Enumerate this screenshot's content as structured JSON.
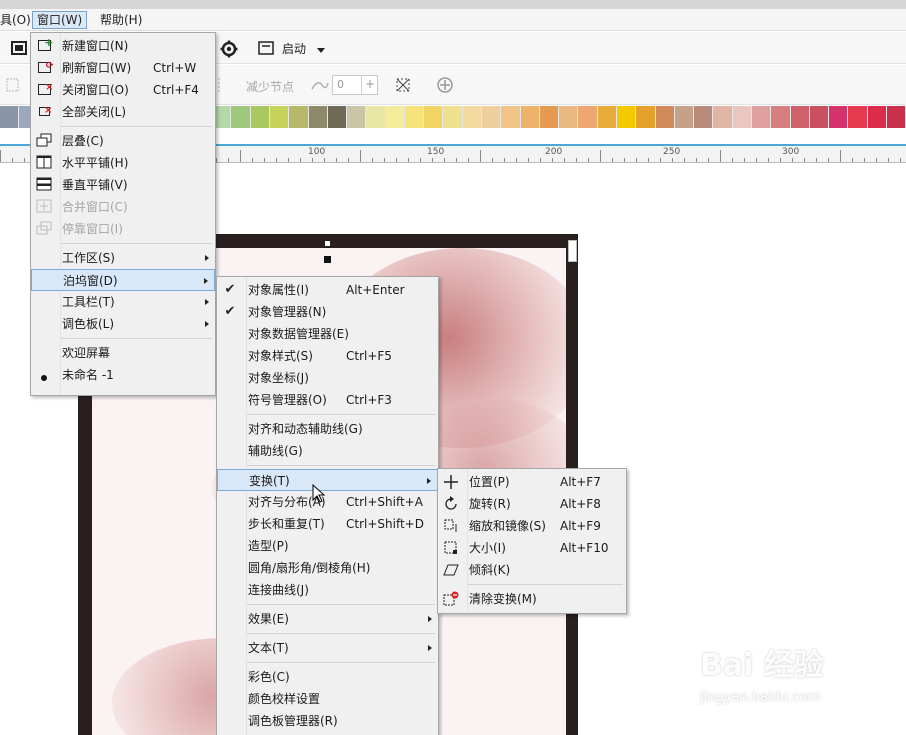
{
  "menubar": {
    "partial_edit": "具(O)",
    "window": "窗口(W)",
    "help": "帮助(H)"
  },
  "toolbar": {
    "startup_label": "启动",
    "reduce_nodes": "减少节点",
    "spin_value": "0"
  },
  "ruler": {
    "labels": [
      "100",
      "150",
      "200",
      "250",
      "300"
    ]
  },
  "palette": {
    "colors": [
      "#8a96a8",
      "#9aa9c0",
      "#6c7fa5",
      "#546b9a",
      "#3d5a8f",
      "#4a78b0",
      "#5c8fc4",
      "#5ea4b0",
      "#4f9b8a",
      "#6ab496",
      "#84c5a4",
      "#b5d8a9",
      "#9dc77a",
      "#a9c860",
      "#c6d35b",
      "#b8b86a",
      "#8c8a6a",
      "#6e6a55",
      "#c9c6a8",
      "#e9e7a5",
      "#f5ec9b",
      "#f6e37a",
      "#f2d465",
      "#ede08e",
      "#f2d9a0",
      "#eed0a0",
      "#f2c487",
      "#eeb36a",
      "#e69a50",
      "#e8b880",
      "#f0a670",
      "#e7ac3a",
      "#f5c800",
      "#e6a12b",
      "#d38a5a",
      "#c6a18a",
      "#b98b7a",
      "#e0b5a6",
      "#e9c6c0",
      "#de9f9f",
      "#d77f7f",
      "#d0606a",
      "#c85060",
      "#d5336b",
      "#e63a50",
      "#dd2b4a",
      "#c9304a"
    ]
  },
  "window_menu": {
    "items": [
      {
        "label": "新建窗口(N)",
        "shortcut": "",
        "icon": "new-window-icon",
        "disabled": false
      },
      {
        "label": "刷新窗口(W)",
        "shortcut": "Ctrl+W",
        "icon": "refresh-window-icon",
        "disabled": false
      },
      {
        "label": "关闭窗口(O)",
        "shortcut": "Ctrl+F4",
        "icon": "close-window-icon",
        "disabled": false
      },
      {
        "label": "全部关闭(L)",
        "shortcut": "",
        "icon": "close-all-icon",
        "disabled": false
      },
      {
        "label": "层叠(C)",
        "shortcut": "",
        "icon": "cascade-icon",
        "disabled": false
      },
      {
        "label": "水平平铺(H)",
        "shortcut": "",
        "icon": "tile-horizontal-icon",
        "disabled": false
      },
      {
        "label": "垂直平铺(V)",
        "shortcut": "",
        "icon": "tile-vertical-icon",
        "disabled": false
      },
      {
        "label": "合并窗口(C)",
        "shortcut": "",
        "icon": "merge-window-icon",
        "disabled": true
      },
      {
        "label": "停靠窗口(I)",
        "shortcut": "",
        "icon": "dock-window-icon",
        "disabled": true
      },
      {
        "label": "工作区(S)",
        "shortcut": "",
        "icon": "",
        "disabled": false,
        "submenu": true
      },
      {
        "label": "泊坞窗(D)",
        "shortcut": "",
        "icon": "",
        "disabled": false,
        "submenu": true,
        "highlight": true
      },
      {
        "label": "工具栏(T)",
        "shortcut": "",
        "icon": "",
        "disabled": false,
        "submenu": true
      },
      {
        "label": "调色板(L)",
        "shortcut": "",
        "icon": "",
        "disabled": false,
        "submenu": true
      },
      {
        "label": "欢迎屏幕",
        "shortcut": "",
        "icon": "",
        "disabled": false
      },
      {
        "label": "未命名 -1",
        "shortcut": "",
        "icon": "bullet-icon",
        "disabled": false
      }
    ]
  },
  "docker_menu": {
    "items": [
      {
        "label": "对象属性(I)",
        "shortcut": "Alt+Enter",
        "checked": true
      },
      {
        "label": "对象管理器(N)",
        "shortcut": "",
        "checked": true
      },
      {
        "label": "对象数据管理器(E)",
        "shortcut": ""
      },
      {
        "label": "对象样式(S)",
        "shortcut": "Ctrl+F5"
      },
      {
        "label": "对象坐标(J)",
        "shortcut": ""
      },
      {
        "label": "符号管理器(O)",
        "shortcut": "Ctrl+F3"
      },
      {
        "label": "对齐和动态辅助线(G)",
        "shortcut": ""
      },
      {
        "label": "辅助线(G)",
        "shortcut": ""
      },
      {
        "label": "变换(T)",
        "shortcut": "",
        "submenu": true,
        "highlight": true
      },
      {
        "label": "对齐与分布(A)",
        "shortcut": "Ctrl+Shift+A"
      },
      {
        "label": "步长和重复(T)",
        "shortcut": "Ctrl+Shift+D"
      },
      {
        "label": "造型(P)",
        "shortcut": ""
      },
      {
        "label": "圆角/扇形角/倒棱角(H)",
        "shortcut": ""
      },
      {
        "label": "连接曲线(J)",
        "shortcut": ""
      },
      {
        "label": "效果(E)",
        "shortcut": "",
        "submenu": true
      },
      {
        "label": "文本(T)",
        "shortcut": "",
        "submenu": true
      },
      {
        "label": "彩色(C)",
        "shortcut": ""
      },
      {
        "label": "颜色校样设置",
        "shortcut": ""
      },
      {
        "label": "调色板管理器(R)",
        "shortcut": ""
      }
    ]
  },
  "transform_menu": {
    "items": [
      {
        "label": "位置(P)",
        "shortcut": "Alt+F7",
        "icon": "position-icon"
      },
      {
        "label": "旋转(R)",
        "shortcut": "Alt+F8",
        "icon": "rotate-icon"
      },
      {
        "label": "缩放和镜像(S)",
        "shortcut": "Alt+F9",
        "icon": "scale-mirror-icon"
      },
      {
        "label": "大小(I)",
        "shortcut": "Alt+F10",
        "icon": "size-icon"
      },
      {
        "label": "倾斜(K)",
        "shortcut": "",
        "icon": "skew-icon"
      },
      {
        "label": "清除变换(M)",
        "shortcut": "",
        "icon": "clear-transform-icon"
      }
    ]
  },
  "watermark": {
    "brand": "Bai 经验",
    "url": "jingyan.baidu.com"
  }
}
